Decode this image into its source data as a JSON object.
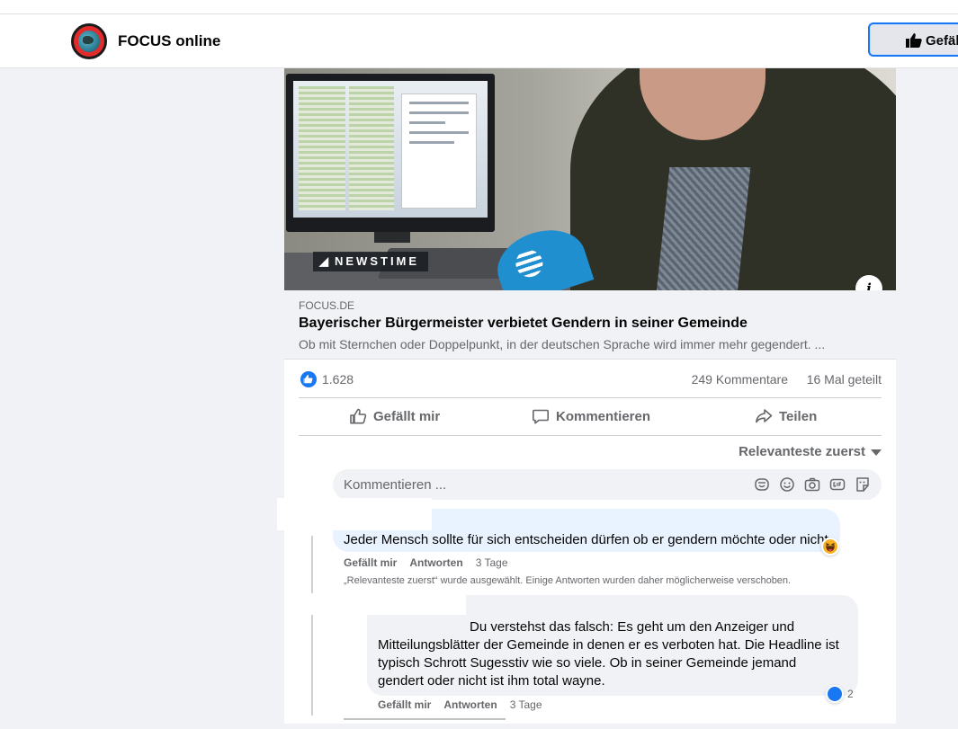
{
  "header": {
    "brand": "FOCUS online",
    "like_button_label": "Gefäll"
  },
  "post": {
    "video": {
      "overlay_logo": "NEWSTIME",
      "info_label": "i"
    },
    "link": {
      "domain": "FOCUS.DE",
      "headline": "Bayerischer Bürgermeister verbietet Gendern in seiner Gemeinde",
      "teaser": "Ob mit Sternchen oder Doppelpunkt, in der deutschen Sprache wird immer mehr gegendert. ..."
    },
    "stats": {
      "likes": "1.628",
      "comments": "249 Kommentare",
      "shares": "16 Mal geteilt"
    },
    "actions": {
      "like": "Gefällt mir",
      "comment": "Kommentieren",
      "share": "Teilen"
    },
    "sort_label": "Relevanteste zuerst",
    "composer_placeholder": "Kommentieren ...",
    "composer_icons": [
      "sticker-icon",
      "emoji-icon",
      "camera-icon",
      "gif-icon",
      "avatar-sticker-icon"
    ]
  },
  "comments": [
    {
      "text": "Jeder Mensch sollte für sich entscheiden dürfen ob er gendern möchte oder nicht.",
      "like_label": "Gefällt mir",
      "reply_label": "Antworten",
      "time": "3 Tage",
      "reaction": "haha-icon"
    }
  ],
  "notice": "„Relevanteste zuerst“ wurde ausgewählt. Einige Antworten wurden daher möglicherweise verschoben.",
  "reply": {
    "text_line1": "Du verstehst das falsch: Es geht um den Anzeiger und",
    "text_rest": "Mitteilungsblätter der Gemeinde in denen er es verboten hat. Die Headline ist typisch Schrott Sugesstiv wie so viele. Ob in seiner Gemeinde jemand gendert oder nicht ist ihm total wayne.",
    "like_label": "Gefällt mir",
    "reply_label": "Antworten",
    "time": "3 Tage",
    "reaction_count": "2"
  }
}
